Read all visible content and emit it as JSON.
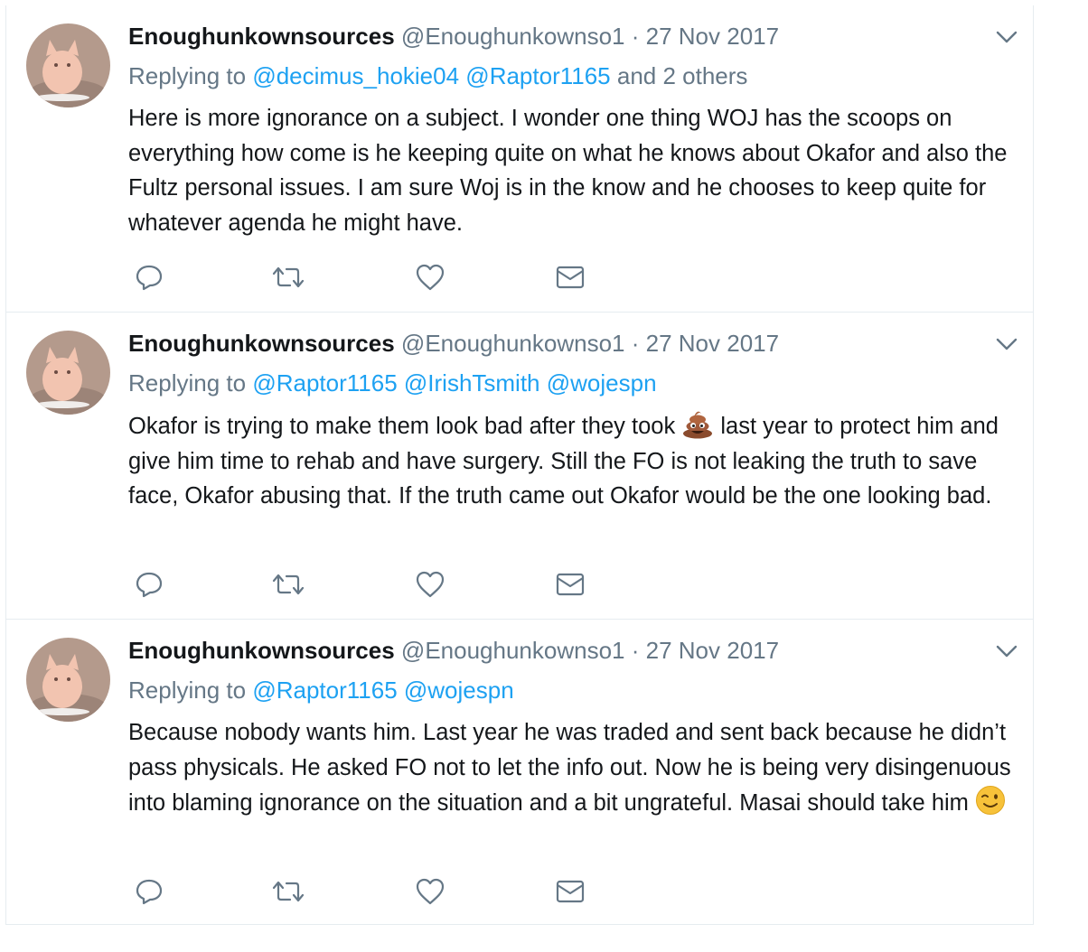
{
  "tweets": [
    {
      "fullname": "Enoughunkownsources",
      "handle": "@Enoughunkownso1",
      "separator": "·",
      "time": "27 Nov 2017",
      "replying_prefix": "Replying to",
      "mentions": [
        "@decimus_hokie04",
        "@Raptor1165"
      ],
      "replying_suffix": "and 2 others",
      "text": "Here is more ignorance on a subject. I wonder one thing WOJ has the scoops on everything how come is he keeping quite on what he knows about Okafor and also the Fultz personal issues. I am sure Woj is in the know and he chooses to keep quite for whatever agenda he might have."
    },
    {
      "fullname": "Enoughunkownsources",
      "handle": "@Enoughunkownso1",
      "separator": "·",
      "time": "27 Nov 2017",
      "replying_prefix": "Replying to",
      "mentions": [
        "@Raptor1165",
        "@IrishTsmith",
        "@wojespn"
      ],
      "replying_suffix": "",
      "text_before_emoji": "Okafor is trying to make them look bad after they took",
      "emoji": "pile-of-poo-emoji",
      "text_after_emoji": "last year to protect him and give him time to rehab and have surgery. Still the FO is not leaking the truth to save face, Okafor abusing that. If the truth came out Okafor would be the one looking bad."
    },
    {
      "fullname": "Enoughunkownsources",
      "handle": "@Enoughunkownso1",
      "separator": "·",
      "time": "27 Nov 2017",
      "replying_prefix": "Replying to",
      "mentions": [
        "@Raptor1165",
        "@wojespn"
      ],
      "replying_suffix": "",
      "text_before_emoji": "Because nobody wants him. Last year he was traded and sent back because he didn’t pass physicals. He asked FO not to let the info out. Now he is being very disingenuous into blaming ignorance on the situation and a bit ungrateful. Masai should take him",
      "emoji": "winking-face-emoji",
      "text_after_emoji": ""
    }
  ],
  "actions": [
    "reply-icon",
    "retweet-icon",
    "like-icon",
    "direct-message-icon"
  ],
  "colors": {
    "link": "#1da1f2",
    "secondary": "#657786",
    "primary_text": "#14171a",
    "border": "#e6ecf0",
    "icon": "#657786"
  }
}
